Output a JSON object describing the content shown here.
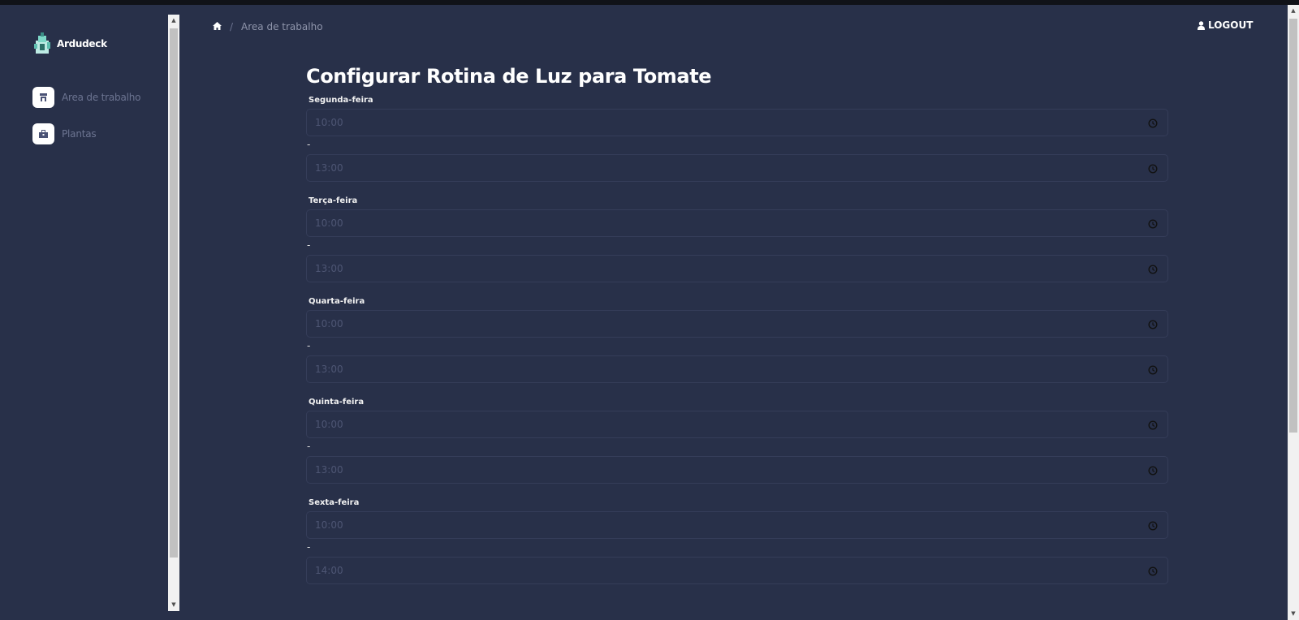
{
  "app": {
    "brand_name": "Ardudeck"
  },
  "sidebar": {
    "items": [
      {
        "label": "Area de trabalho",
        "icon": "store-icon"
      },
      {
        "label": "Plantas",
        "icon": "briefcase-icon"
      }
    ]
  },
  "breadcrumb": {
    "home_icon": "home-icon",
    "separator": "/",
    "current": "Area de trabalho"
  },
  "header": {
    "logout_label": "LOGOUT",
    "logout_icon": "user-icon"
  },
  "main": {
    "title": "Configurar Rotina de Luz para Tomate",
    "separator": "-",
    "days": [
      {
        "label": "Segunda-feira",
        "start": "10:00",
        "end": "13:00"
      },
      {
        "label": "Terça-feira",
        "start": "10:00",
        "end": "13:00"
      },
      {
        "label": "Quarta-feira",
        "start": "10:00",
        "end": "13:00"
      },
      {
        "label": "Quinta-feira",
        "start": "10:00",
        "end": "13:00"
      },
      {
        "label": "Sexta-feira",
        "start": "10:00",
        "end": "14:00"
      }
    ]
  },
  "colors": {
    "background": "#283049",
    "field_border": "#353d59",
    "muted_text": "#6c7491"
  }
}
